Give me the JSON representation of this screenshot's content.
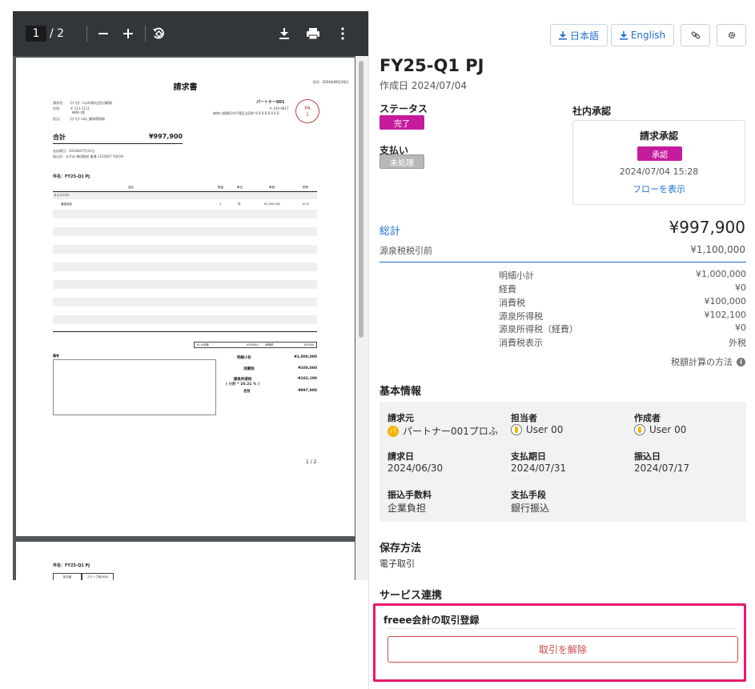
{
  "viewer": {
    "current_page": "1",
    "total_pages": "/ 2",
    "icons": [
      "zoom-out-icon",
      "zoom-in-icon",
      "rotate-icon",
      "download-icon",
      "print-icon",
      "more-icon"
    ],
    "doc": {
      "title": "請求書",
      "date": "日付：2024年06月30日",
      "billing_to_lines": [
        "請求先:　　【デモ】つばめ株式会社(御請)",
        "住所:　　　〒 111-1111",
        "　　　　　　神奈川県",
        "担当:　　　【デモ】kitu_開発環境様"
      ],
      "partner": "パートナー001",
      "partner_lines": [
        "〒 244-0817",
        "神奈川県横浜市戸塚区吉田町 8 8 8 8 8 8 8 8"
      ],
      "stamp": "PA\n1",
      "total_label": "合計",
      "total_value": "¥997,900",
      "due_lines": [
        "支払期日：2024年07月31日",
        "振込先：みずほ 神田駅前 普通 1234567 YUICHI"
      ],
      "item_title": "件名：FY25-Q1 PJ",
      "columns": [
        "品名",
        "数量",
        "単位",
        "単価",
        "税率"
      ],
      "row_group": "タスク0703",
      "row": {
        "name": "最高商品",
        "qty": "1",
        "unit": "件",
        "price": "¥1,000,000",
        "tax": "10 %"
      },
      "tax_box": [
        "10 %対象",
        "1000000",
        "消費税",
        "100000"
      ],
      "remark_label": "備考",
      "sums": [
        {
          "label": "明細小計",
          "value": "¥1,000,000"
        },
        {
          "label": "消費税",
          "value": "¥100,000"
        },
        {
          "label": "源泉所得税\n( 小計 * 10.21 % )",
          "value": "-¥102,100"
        },
        {
          "label": "合計",
          "value": "¥997,900"
        }
      ],
      "page_num": "1 / 2",
      "page2_title": "件名：FY25-Q1 PJ",
      "page2_cells": [
        "担当者",
        "ステップ色0620"
      ]
    }
  },
  "panel": {
    "lang_ja": "日本語",
    "lang_en": "English",
    "title": "FY25-Q1 PJ",
    "created": "作成日 2024/07/04",
    "status_label": "ステータス",
    "status_badge": "完了",
    "payment_label": "支払い",
    "payment_badge": "未処理",
    "approval_heading": "社内承認",
    "approval": {
      "title": "請求承認",
      "badge": "承認",
      "time": "2024/07/04 15:28",
      "link": "フローを表示"
    },
    "total_label": "総計",
    "total_amount": "¥997,900",
    "withhold_label": "源泉税税引前",
    "withhold_amount": "¥1,100,000",
    "breakdown": [
      {
        "label": "明細小計",
        "value": "¥1,000,000"
      },
      {
        "label": "経費",
        "value": "¥0"
      },
      {
        "label": "消費税",
        "value": "¥100,000"
      },
      {
        "label": "源泉所得税",
        "value": "¥102,100"
      },
      {
        "label": "源泉所得税（経費）",
        "value": "¥0"
      },
      {
        "label": "消費税表示",
        "value": "外税"
      }
    ],
    "tax_method": "税額計算の方法",
    "basic_info_heading": "基本情報",
    "basic_info": {
      "billing_from_label": "請求元",
      "billing_from_value": "パートナー001プロふ",
      "billing_from_avatar": "パ",
      "assignee_label": "担当者",
      "assignee_value": "User 00",
      "creator_label": "作成者",
      "creator_value": "User 00",
      "invoice_date_label": "請求日",
      "invoice_date_value": "2024/06/30",
      "due_date_label": "支払期日",
      "due_date_value": "2024/07/31",
      "transfer_date_label": "振込日",
      "transfer_date_value": "2024/07/17",
      "fee_label": "振込手数料",
      "fee_value": "企業負担",
      "method_label": "支払手段",
      "method_value": "銀行振込"
    },
    "storage_heading": "保存方法",
    "storage_value": "電子取引",
    "service_heading": "サービス連携",
    "freee_title": "freee会計の取引登録",
    "unlink_button": "取引を解除"
  }
}
